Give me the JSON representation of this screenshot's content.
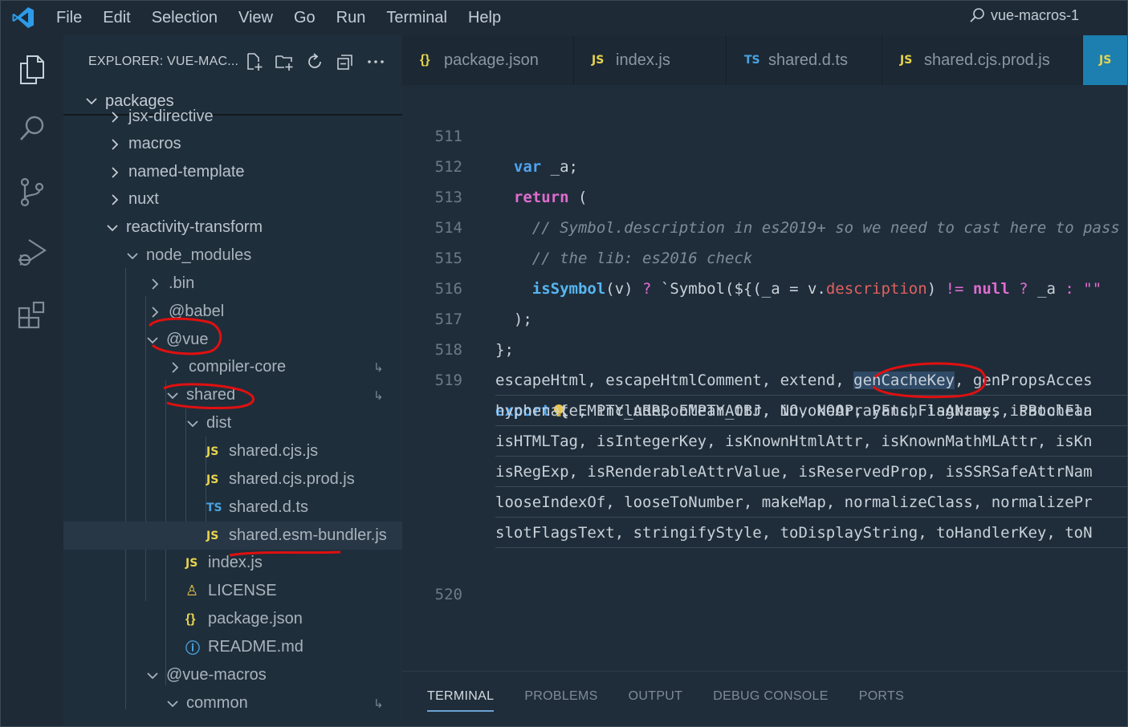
{
  "titlebar": {
    "menu": [
      "File",
      "Edit",
      "Selection",
      "View",
      "Go",
      "Run",
      "Terminal",
      "Help"
    ],
    "search_text": "vue-macros-1"
  },
  "sidebar": {
    "title": "EXPLORER: VUE-MAC...",
    "root": "packages",
    "rows": [
      {
        "label": "jsx-directive",
        "kind": "folder",
        "expanded": false
      },
      {
        "label": "macros",
        "kind": "folder",
        "expanded": false
      },
      {
        "label": "named-template",
        "kind": "folder",
        "expanded": false
      },
      {
        "label": "nuxt",
        "kind": "folder",
        "expanded": false
      },
      {
        "label": "reactivity-transform",
        "kind": "folder",
        "expanded": true
      },
      {
        "label": "node_modules",
        "kind": "folder",
        "expanded": true
      },
      {
        "label": ".bin",
        "kind": "folder",
        "expanded": false
      },
      {
        "label": "@babel",
        "kind": "folder",
        "expanded": false
      },
      {
        "label": "@vue",
        "kind": "folder",
        "expanded": true
      },
      {
        "label": "compiler-core",
        "kind": "folder",
        "expanded": false,
        "symlink": true
      },
      {
        "label": "shared",
        "kind": "folder",
        "expanded": true,
        "symlink": true
      },
      {
        "label": "dist",
        "kind": "folder",
        "expanded": true
      },
      {
        "label": "shared.cjs.js",
        "kind": "js"
      },
      {
        "label": "shared.cjs.prod.js",
        "kind": "js"
      },
      {
        "label": "shared.d.ts",
        "kind": "ts"
      },
      {
        "label": "shared.esm-bundler.js",
        "kind": "js",
        "selected": true
      },
      {
        "label": "index.js",
        "kind": "js"
      },
      {
        "label": "LICENSE",
        "kind": "license"
      },
      {
        "label": "package.json",
        "kind": "json"
      },
      {
        "label": "README.md",
        "kind": "info"
      },
      {
        "label": "@vue-macros",
        "kind": "folder",
        "expanded": true
      },
      {
        "label": "common",
        "kind": "folder",
        "expanded": true,
        "symlink": true
      }
    ]
  },
  "tabs": [
    {
      "label": "package.json",
      "icon": "{}",
      "kind": "json"
    },
    {
      "label": "index.js",
      "icon": "JS",
      "kind": "js"
    },
    {
      "label": "shared.d.ts",
      "icon": "TS",
      "kind": "ts"
    },
    {
      "label": "shared.cjs.prod.js",
      "icon": "JS",
      "kind": "js"
    },
    {
      "label": "",
      "icon": "JS",
      "kind": "js",
      "active": true
    }
  ],
  "editor": {
    "line_numbers": [
      "511",
      "512",
      "513",
      "514",
      "515",
      "516",
      "517",
      "518",
      "519",
      "520"
    ],
    "wrap_lines": [
      "escapeHtml, escapeHtmlComment, extend, genCacheKey, genPropsAcces",
      "hyphenate, includeBooleanAttr, invokeArrayFns, isArray, isBoolean",
      "isHTMLTag, isIntegerKey, isKnownHtmlAttr, isKnownMathMLAttr, isKn",
      "isRegExp, isRenderableAttrValue, isReservedProp, isSSRSafeAttrNam",
      "looseIndexOf, looseToNumber, makeMap, normalizeClass, normalizePr",
      "slotFlagsText, stringifyStyle, toDisplayString, toHandlerKey, toN"
    ],
    "highlighted_word": "genCacheKey"
  },
  "panel": {
    "tabs": [
      "TERMINAL",
      "PROBLEMS",
      "OUTPUT",
      "DEBUG CONSOLE",
      "PORTS"
    ],
    "active": "TERMINAL"
  }
}
